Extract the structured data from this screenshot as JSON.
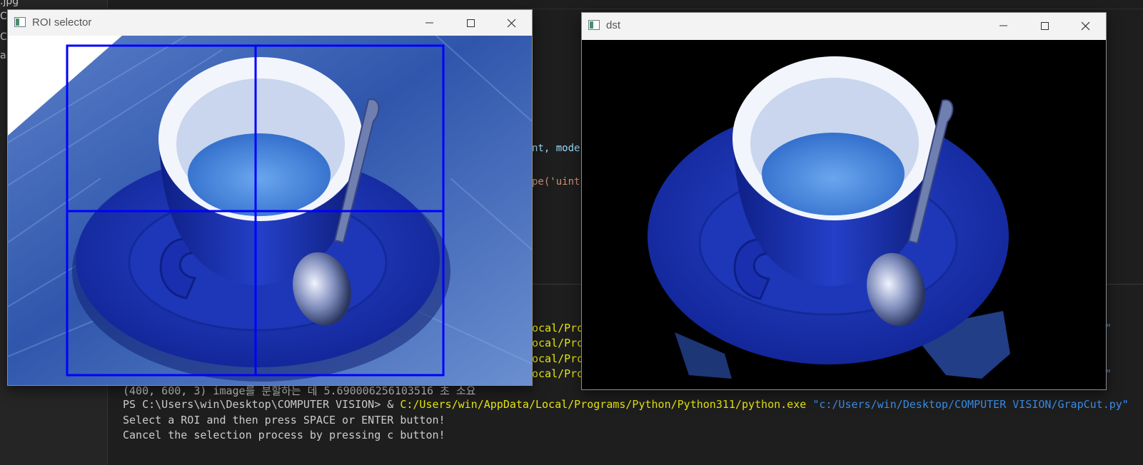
{
  "explorer": {
    "fragments": [
      "",
      ".jpg",
      "C",
      "C",
      "ai"
    ]
  },
  "editor": {
    "code_fragment_1": "nt, mode",
    "code_fragment_2": "pe('uint"
  },
  "terminal": {
    "partial_lines": [
      {
        "text": "ocal/Pro",
        "end": "\""
      },
      {
        "text": "ocal/Pro",
        "end": ""
      },
      {
        "text": "ocal/Pro",
        "end": ""
      },
      {
        "text": "ocal/Pro",
        "end": "\""
      }
    ],
    "timing_line": "(400, 600, 3) image를 분할하는 데 5.690006256103516 초 소요",
    "prompt": "PS C:\\Users\\win\\Desktop\\COMPUTER VISION> & ",
    "exe_path": "C:/Users/win/AppData/Local/Programs/Python/Python311/python.exe",
    "script_path": "\"c:/Users/win/Desktop/COMPUTER VISION/GrapCut.py\"",
    "line_select": "Select a ROI and then press SPACE or ENTER button!",
    "line_cancel": "Cancel the selection process by pressing c button!"
  },
  "roi_window": {
    "title": "ROI selector",
    "roi_color": "#0000ff"
  },
  "dst_window": {
    "title": "dst"
  },
  "colors": {
    "cup_blue": "#1a2fb0",
    "cup_white": "#eef2fb",
    "coffee": "#3f7fd6",
    "saucer": "#1f3ab8",
    "table": "#3a63b3"
  }
}
